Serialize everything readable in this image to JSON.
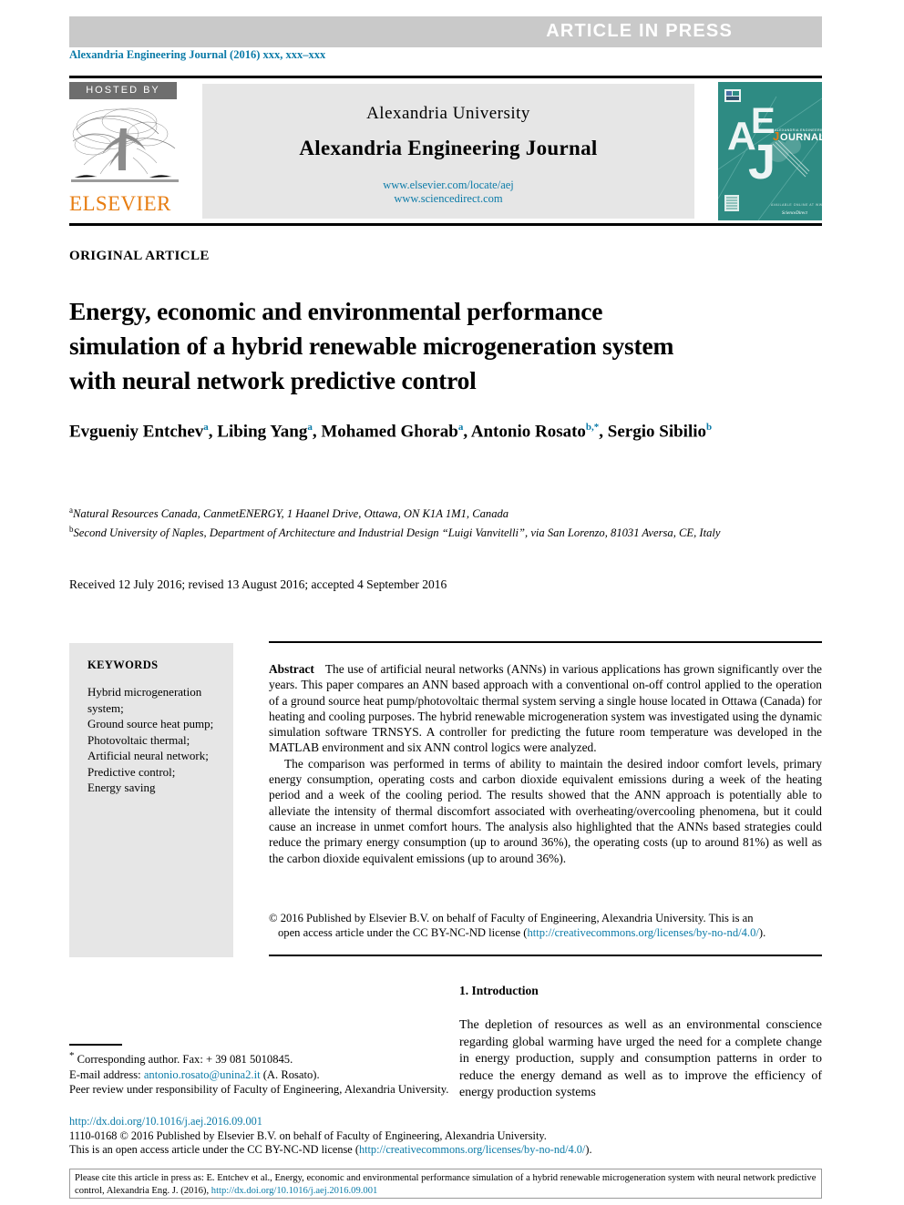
{
  "banner": {
    "text": "ARTICLE  IN  PRESS",
    "background_color": "#c9c9c9",
    "text_color": "#ffffff"
  },
  "journal_ref": "Alexandria Engineering Journal (2016) xxx, xxx–xxx",
  "masthead": {
    "hosted_by": "HOSTED BY",
    "publisher": "ELSEVIER",
    "university": "Alexandria University",
    "journal_title": "Alexandria Engineering Journal",
    "url_elsevier": "www.elsevier.com/locate/aej",
    "url_sciencedirect": "www.sciencedirect.com",
    "cover_letters": "AEJ",
    "cover_word": "OURNAL",
    "cover_word_initial": "J",
    "cover_tagline": "ALEXANDRIA ENGINEERING",
    "cover_background_color": "#2e8b83",
    "accent_color": "#0b7ba8",
    "elsevier_orange": "#e77d12"
  },
  "article": {
    "type_label": "ORIGINAL ARTICLE",
    "title": "Energy, economic and environmental performance simulation of a hybrid renewable microgeneration system with neural network predictive control",
    "authors": [
      {
        "name": "Evgueniy Entchev",
        "sup": "a"
      },
      {
        "name": "Libing Yang",
        "sup": "a"
      },
      {
        "name": "Mohamed Ghorab",
        "sup": "a"
      },
      {
        "name": "Antonio Rosato",
        "sup": "b,*"
      },
      {
        "name": "Sergio Sibilio",
        "sup": "b"
      }
    ],
    "affiliations": [
      {
        "mark": "a",
        "text": "Natural Resources Canada, CanmetENERGY, 1 Haanel Drive, Ottawa, ON K1A 1M1, Canada"
      },
      {
        "mark": "b",
        "text": "Second University of Naples, Department of Architecture and Industrial Design “Luigi Vanvitelli”, via San Lorenzo, 81031 Aversa, CE, Italy"
      }
    ],
    "dates": "Received 12 July 2016; revised 13 August 2016; accepted 4 September 2016"
  },
  "keywords": {
    "heading": "KEYWORDS",
    "items": [
      "Hybrid microgeneration system;",
      "Ground source heat pump;",
      "Photovoltaic thermal;",
      "Artificial neural network;",
      "Predictive control;",
      "Energy saving"
    ]
  },
  "abstract": {
    "label": "Abstract",
    "paragraph_1": "The use of artificial neural networks (ANNs) in various applications has grown significantly over the years. This paper compares an ANN based approach with a conventional on-off control applied to the operation of a ground source heat pump/photovoltaic thermal system serving a single house located in Ottawa (Canada) for heating and cooling purposes. The hybrid renewable microgeneration system was investigated using the dynamic simulation software TRNSYS. A controller for predicting the future room temperature was developed in the MATLAB environment and six ANN control logics were analyzed.",
    "paragraph_2": "The comparison was performed in terms of ability to maintain the desired indoor comfort levels, primary energy consumption, operating costs and carbon dioxide equivalent emissions during a week of the heating period and a week of the cooling period. The results showed that the ANN approach is potentially able to alleviate the intensity of thermal discomfort associated with overheating/overcooling phenomena, but it could cause an increase in unmet comfort hours. The analysis also highlighted that the ANNs based strategies could reduce the primary energy consumption (up to around 36%), the operating costs (up to around 81%) as well as the carbon dioxide equivalent emissions (up to around 36%).",
    "copyright_line_1": "© 2016 Published by Elsevier B.V. on behalf of Faculty of Engineering, Alexandria University. This is an",
    "copyright_line_2_pre": "open access article under the CC BY-NC-ND license (",
    "copyright_license_url": "http://creativecommons.org/licenses/by-no-nd/4.0/",
    "copyright_line_2_post": ")."
  },
  "introduction": {
    "heading": "1. Introduction",
    "text": "The depletion of resources as well as an environmental conscience regarding global warming have urged the need for a complete change in energy production, supply and consumption patterns in order to reduce the energy demand as well as to improve the efficiency of energy production systems"
  },
  "footnote": {
    "corresponding": "Corresponding author. Fax: + 39 081 5010845.",
    "email_label": "E-mail address:",
    "email": "antonio.rosato@unina2.it",
    "email_suffix": "(A. Rosato).",
    "peer_review": "Peer review under responsibility of Faculty of Engineering, Alexandria University."
  },
  "footer": {
    "doi": "http://dx.doi.org/10.1016/j.aej.2016.09.001",
    "issn_line": "1110-0168 © 2016 Published by Elsevier B.V. on behalf of Faculty of Engineering, Alexandria University.",
    "license_pre": "This is an open access article under the CC BY-NC-ND license (",
    "license_url": "http://creativecommons.org/licenses/by-no-nd/4.0/",
    "license_post": ")."
  },
  "cite_box": {
    "line_1": "Please cite this article in press as: E. Entchev et al., Energy, economic and environmental performance simulation of a hybrid renewable microgeneration system with",
    "line_2_pre": "neural network predictive control,  Alexandria Eng. J. (2016),",
    "line_2_url": "http://dx.doi.org/10.1016/j.aej.2016.09.001"
  }
}
